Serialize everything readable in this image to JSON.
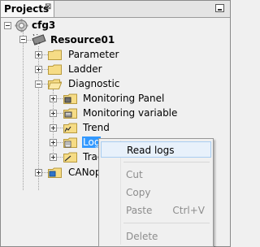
{
  "panel": {
    "tab_label": "Projects",
    "tab_close_glyph": "⊠"
  },
  "tree": {
    "root": "cfg3",
    "resource": "Resource01",
    "folders": {
      "parameter": "Parameter",
      "ladder": "Ladder",
      "diagnostic": "Diagnostic",
      "monitoring_panel": "Monitoring Panel",
      "monitoring_variable": "Monitoring variable",
      "trend": "Trend",
      "logs": "Log",
      "trace": "Trac",
      "canopen": "CANope"
    }
  },
  "context_menu": {
    "read_logs": "Read logs",
    "cut": "Cut",
    "copy": "Copy",
    "paste": "Paste",
    "paste_shortcut": "Ctrl+V",
    "delete": "Delete"
  },
  "colors": {
    "selection": "#3399ff",
    "folder": "#f5d67a",
    "menu_hover": "#e8f1fb"
  }
}
